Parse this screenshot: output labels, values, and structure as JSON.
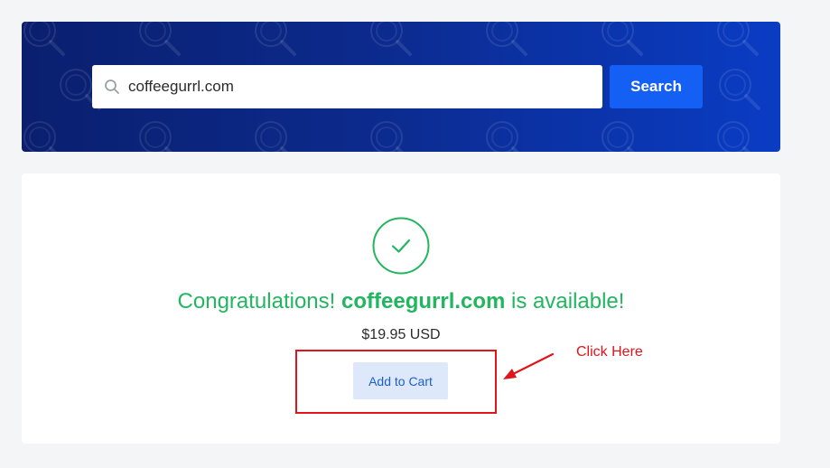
{
  "search": {
    "value": "coffeegurrl.com",
    "button_label": "Search"
  },
  "result": {
    "headline_prefix": "Congratulations! ",
    "domain": "coffeegurrl.com",
    "headline_suffix": " is available!",
    "price": "$19.95 USD",
    "cart_label": "Add to Cart"
  },
  "annotation": {
    "text": "Click Here"
  },
  "colors": {
    "success": "#22b660",
    "primary": "#1560f4",
    "annotation": "#e0151b"
  },
  "icons": {
    "search": "search-icon",
    "success": "check-circle-icon",
    "pointer": "arrow-icon"
  }
}
